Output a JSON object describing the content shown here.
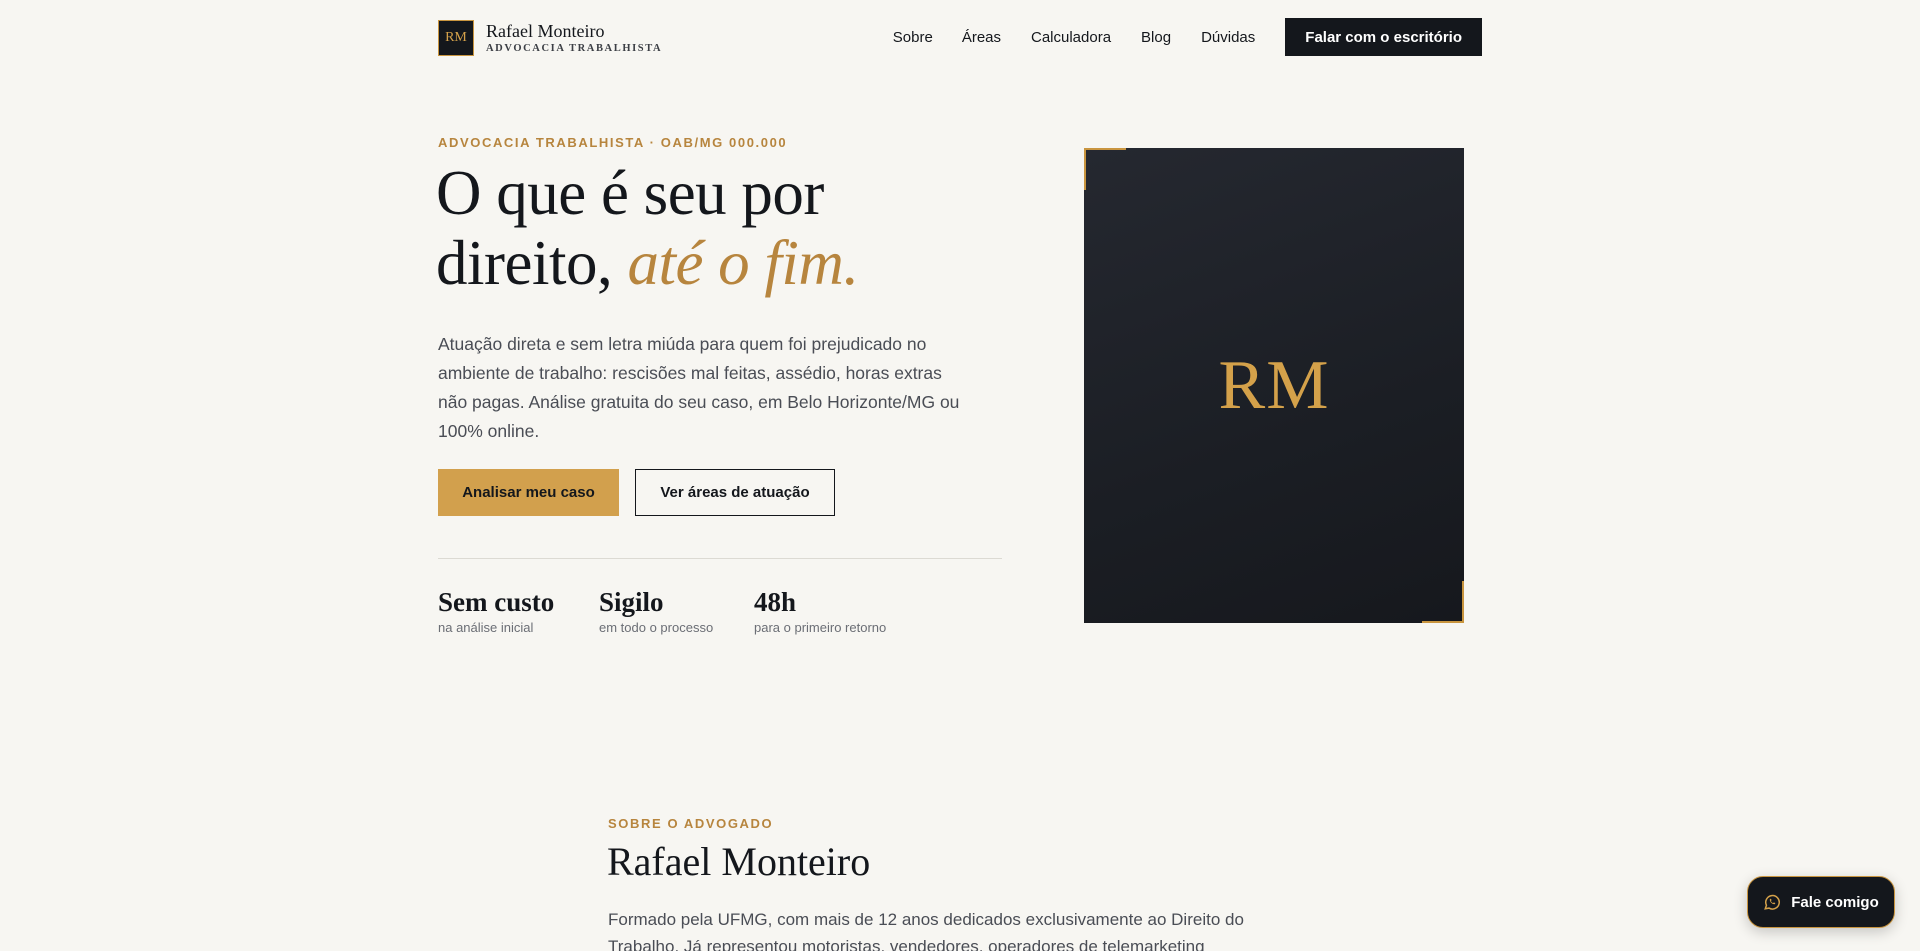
{
  "header": {
    "logo_mark": "RM",
    "logo_name": "Rafael Monteiro",
    "logo_subtitle": "ADVOCACIA TRABALHISTA",
    "nav": [
      "Sobre",
      "Áreas",
      "Calculadora",
      "Blog",
      "Dúvidas"
    ],
    "cta_label": "Falar com o escritório"
  },
  "hero": {
    "eyebrow": "ADVOCACIA TRABALHISTA · OAB/MG 000.000",
    "title_line1": "O que é seu por",
    "title_line2_plain": "direito, ",
    "title_line2_accent": "até o fim.",
    "lead": "Atuação direta e sem letra miúda para quem foi prejudicado no ambiente de trabalho: rescisões mal feitas, assédio, horas extras não pagas. Análise gratuita do seu caso, em Belo Horizonte/MG ou 100% online.",
    "primary_button": "Analisar meu caso",
    "secondary_button": "Ver áreas de atuação",
    "stats": [
      {
        "title": "Sem custo",
        "subtitle": "na análise inicial"
      },
      {
        "title": "Sigilo",
        "subtitle": "em todo o processo"
      },
      {
        "title": "48h",
        "subtitle": "para o primeiro retorno"
      }
    ],
    "card_monogram": "RM"
  },
  "about": {
    "eyebrow": "SOBRE O ADVOGADO",
    "title": "Rafael Monteiro",
    "text": "Formado pela UFMG, com mais de 12 anos dedicados exclusivamente ao Direito do Trabalho. Já representou motoristas, vendedores, operadores de telemarketing"
  },
  "chat": {
    "label": "Fale comigo",
    "icon": "whatsapp-icon"
  },
  "colors": {
    "background": "#f7f6f2",
    "ink": "#14171c",
    "gold": "#d2a04d",
    "gold_text": "#b7853e",
    "muted": "#4a4d55"
  }
}
